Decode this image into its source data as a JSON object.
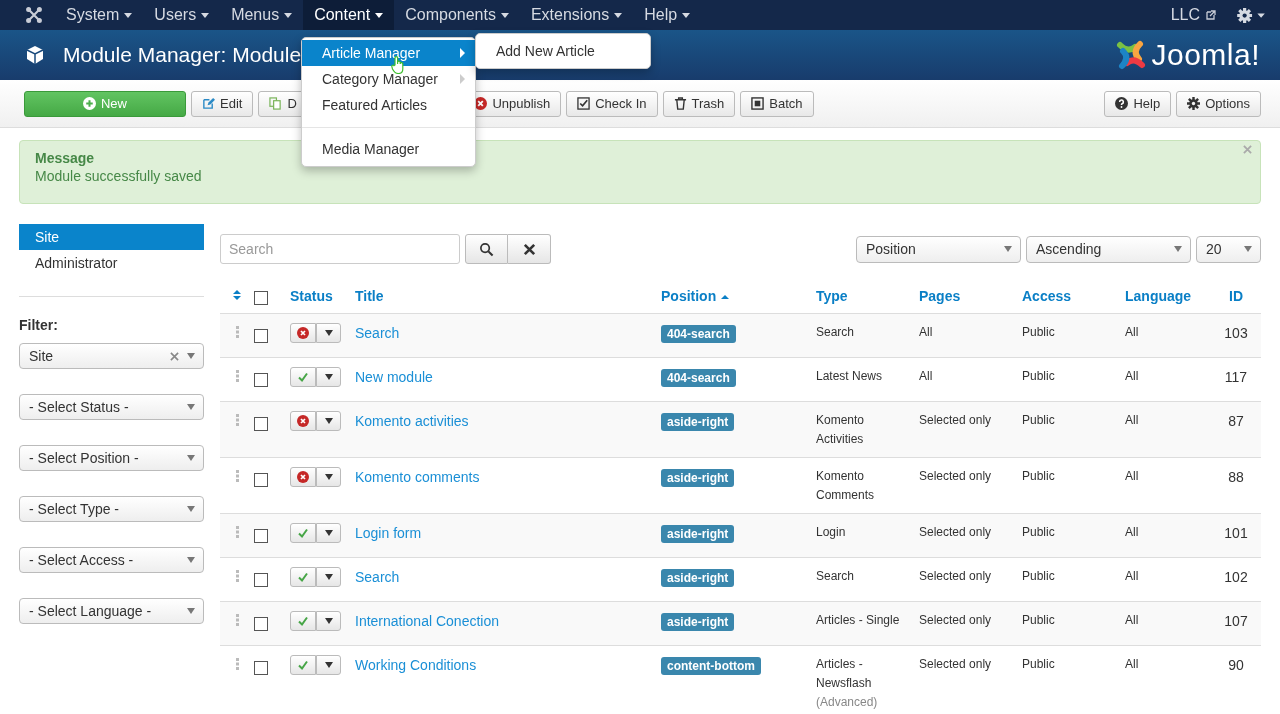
{
  "nav": {
    "items": [
      {
        "label": "System",
        "selected": false
      },
      {
        "label": "Users",
        "selected": false
      },
      {
        "label": "Menus",
        "selected": false
      },
      {
        "label": "Content",
        "selected": true
      },
      {
        "label": "Components",
        "selected": false
      },
      {
        "label": "Extensions",
        "selected": false
      },
      {
        "label": "Help",
        "selected": false
      }
    ],
    "user": "LLC"
  },
  "header": {
    "title": "Module Manager: Module",
    "logo": "Joomla!"
  },
  "toolbar": {
    "left": [
      {
        "label": "New",
        "kind": "new"
      },
      {
        "label": "Edit",
        "kind": "edit"
      },
      {
        "label": "D",
        "kind": "duplicate"
      },
      {
        "label": "Unpublish",
        "kind": "unpublish"
      },
      {
        "label": "Check In",
        "kind": "checkin"
      },
      {
        "label": "Trash",
        "kind": "trash"
      },
      {
        "label": "Batch",
        "kind": "batch"
      }
    ],
    "right": [
      {
        "label": "Help",
        "kind": "help"
      },
      {
        "label": "Options",
        "kind": "options"
      }
    ]
  },
  "menu": {
    "items": [
      {
        "label": "Article Manager",
        "selected": true,
        "submenu": true
      },
      {
        "label": "Category Manager",
        "selected": false,
        "submenu": true
      },
      {
        "label": "Featured Articles",
        "selected": false,
        "submenu": false
      },
      {
        "kind": "divider"
      },
      {
        "label": "Media Manager",
        "selected": false,
        "submenu": false
      }
    ],
    "submenu": [
      "Add New Article"
    ]
  },
  "message": {
    "heading": "Message",
    "text": "Module successfully saved"
  },
  "sidebar": {
    "items": [
      {
        "label": "Site",
        "selected": true
      },
      {
        "label": "Administrator",
        "selected": false
      }
    ],
    "filter_label": "Filter:",
    "filters": [
      {
        "value": "Site",
        "clearable": true
      },
      {
        "value": "- Select Status -",
        "clearable": false
      },
      {
        "value": "- Select Position -",
        "clearable": false
      },
      {
        "value": "- Select Type -",
        "clearable": false
      },
      {
        "value": "- Select Access -",
        "clearable": false
      },
      {
        "value": "- Select Language -",
        "clearable": false
      }
    ]
  },
  "search": {
    "placeholder": "Search"
  },
  "sort": {
    "field": "Position",
    "direction": "Ascending",
    "limit": "20"
  },
  "table": {
    "select_all_checked": false,
    "columns": [
      "Status",
      "Title",
      "Position",
      "Type",
      "Pages",
      "Access",
      "Language",
      "ID"
    ],
    "rows": [
      {
        "checked": false,
        "published": false,
        "title": "Search",
        "position": "404-search",
        "type": [
          "Search"
        ],
        "pages": "All",
        "access": "Public",
        "language": "All",
        "id": "103"
      },
      {
        "checked": false,
        "published": true,
        "title": "New module",
        "position": "404-search",
        "type": [
          "Latest News"
        ],
        "pages": "All",
        "access": "Public",
        "language": "All",
        "id": "117"
      },
      {
        "checked": false,
        "published": false,
        "title": "Komento activities",
        "position": "aside-right",
        "type": [
          "Komento",
          "Activities"
        ],
        "pages": "Selected only",
        "access": "Public",
        "language": "All",
        "id": "87"
      },
      {
        "checked": false,
        "published": false,
        "title": "Komento comments",
        "position": "aside-right",
        "type": [
          "Komento",
          "Comments"
        ],
        "pages": "Selected only",
        "access": "Public",
        "language": "All",
        "id": "88"
      },
      {
        "checked": false,
        "published": true,
        "title": "Login form",
        "position": "aside-right",
        "type": [
          "Login"
        ],
        "pages": "Selected only",
        "access": "Public",
        "language": "All",
        "id": "101"
      },
      {
        "checked": false,
        "published": true,
        "title": "Search",
        "position": "aside-right",
        "type": [
          "Search"
        ],
        "pages": "Selected only",
        "access": "Public",
        "language": "All",
        "id": "102"
      },
      {
        "checked": false,
        "published": true,
        "title": "International Conection",
        "position": "aside-right",
        "type": [
          "Articles - Single"
        ],
        "pages": "Selected only",
        "access": "Public",
        "language": "All",
        "id": "107"
      },
      {
        "checked": false,
        "published": true,
        "title": "Working Conditions",
        "position": "content-bottom",
        "type": [
          "Articles -",
          "Newsflash"
        ],
        "type_note": "(Advanced)",
        "pages": "Selected only",
        "access": "Public",
        "language": "All",
        "id": "90"
      }
    ]
  }
}
